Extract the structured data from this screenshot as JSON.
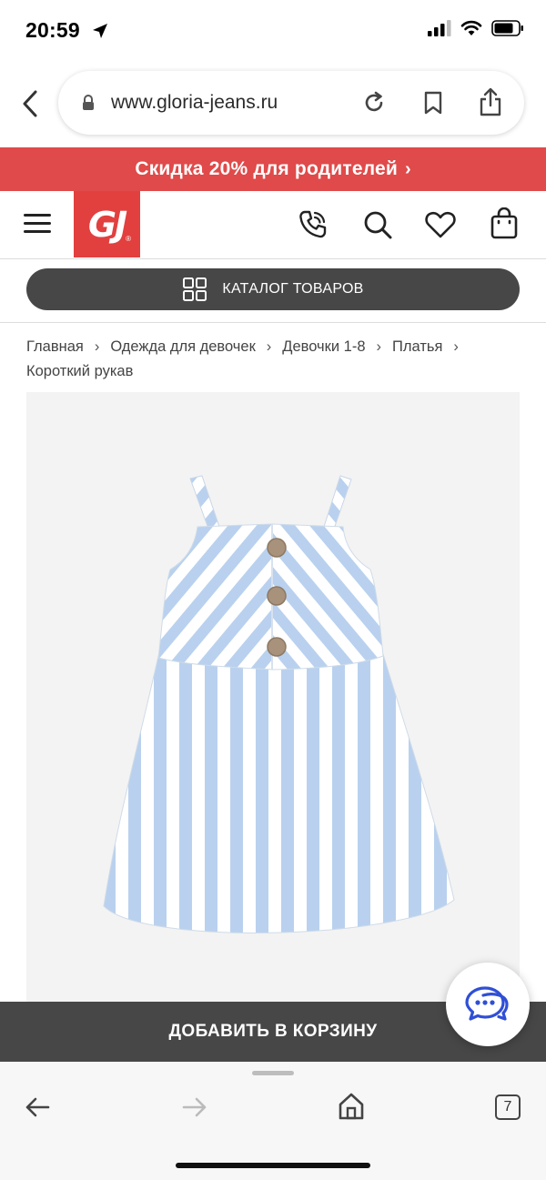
{
  "status_bar": {
    "time": "20:59"
  },
  "browser": {
    "url": "www.gloria-jeans.ru"
  },
  "promo": {
    "text": "Скидка 20% для родителей"
  },
  "header": {
    "logo_text": "GJ",
    "logo_mark": "®",
    "icons": [
      "menu-icon",
      "phone-icon",
      "search-icon",
      "heart-icon",
      "bag-icon"
    ]
  },
  "catalog": {
    "label": "КАТАЛОГ ТОВАРОВ"
  },
  "breadcrumb": {
    "items": [
      "Главная",
      "Одежда для девочек",
      "Девочки 1-8",
      "Платья",
      "Короткий рукав"
    ]
  },
  "product": {
    "image_alt_colors": {
      "stripe": "#b9d1ee",
      "base": "#ffffff",
      "button": "#a8927b"
    }
  },
  "cart": {
    "label": "ДОБАВИТЬ В КОРЗИНУ"
  },
  "toolbar": {
    "tabs_count": "7"
  },
  "colors": {
    "brand_red": "#e1403f",
    "promo_red": "#e04a4a",
    "dark_button": "#474747",
    "chat_blue": "#2f4fd6"
  }
}
